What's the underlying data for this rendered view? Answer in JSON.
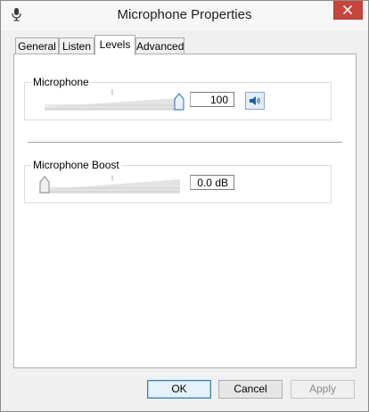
{
  "window": {
    "title": "Microphone Properties",
    "app_icon": "microphone-icon",
    "close_icon": "close-icon"
  },
  "tabs": [
    {
      "label": "General",
      "active": false
    },
    {
      "label": "Listen",
      "active": false
    },
    {
      "label": "Levels",
      "active": true
    },
    {
      "label": "Advanced",
      "active": false
    }
  ],
  "levels": {
    "microphone": {
      "label": "Microphone",
      "value": "100",
      "level_percent": 100,
      "mute_icon": "speaker-icon"
    },
    "boost": {
      "label": "Microphone Boost",
      "value": "0.0 dB",
      "level_percent": 0
    }
  },
  "buttons": {
    "ok": "OK",
    "cancel": "Cancel",
    "apply": "Apply"
  },
  "colors": {
    "accent": "#3c7fb1",
    "close": "#c7463b"
  }
}
